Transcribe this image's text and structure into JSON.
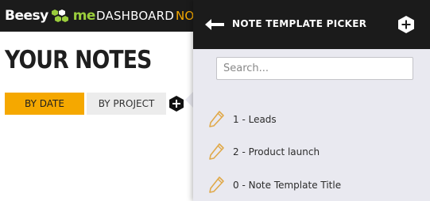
{
  "brand": {
    "name": "Beesy",
    "suffix": "me"
  },
  "nav": {
    "dashboard_label": "DASHBOARD",
    "notes_label": "NOTES",
    "accent_color": "#f5a800"
  },
  "page": {
    "title": "YOUR NOTES",
    "tabs": [
      {
        "label": "BY DATE",
        "active": true
      },
      {
        "label": "BY PROJECT",
        "active": false
      }
    ],
    "add_icon": "plus-hexagon-icon"
  },
  "picker": {
    "title": "NOTE TEMPLATE PICKER",
    "back_icon": "arrow-left-icon",
    "add_icon": "plus-hexagon-icon",
    "search": {
      "placeholder": "Search...",
      "value": ""
    },
    "items": [
      {
        "label": "1 - Leads",
        "icon": "pencil-icon"
      },
      {
        "label": "2 - Product launch",
        "icon": "pencil-icon"
      },
      {
        "label": "0 - Note Template Title",
        "icon": "pencil-icon"
      }
    ]
  }
}
